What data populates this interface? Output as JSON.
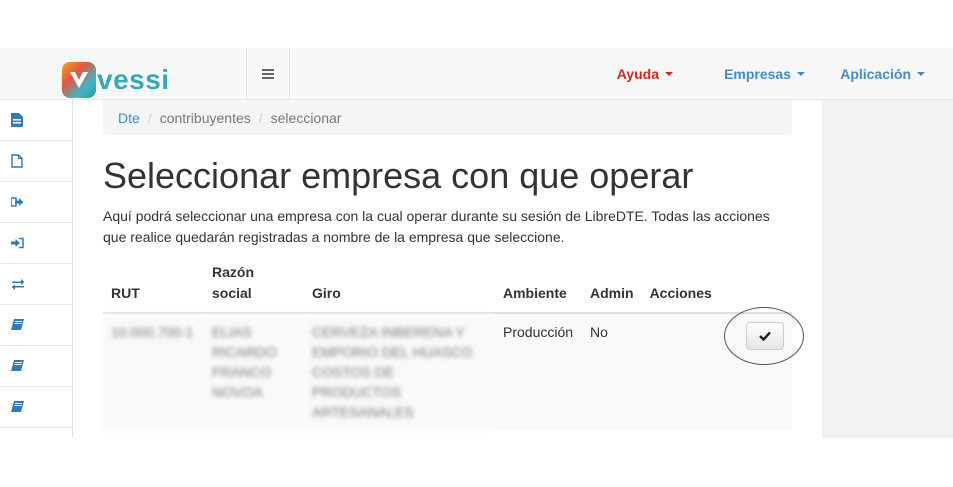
{
  "brand": {
    "name": "vessi"
  },
  "navbar": {
    "toggle_icon": "hamburger-icon",
    "menus": [
      {
        "label": "Ayuda",
        "color": "#d9251c"
      },
      {
        "label": "Empresas",
        "color": "#428bca"
      },
      {
        "label": "Aplicación",
        "color": "#428bca"
      }
    ]
  },
  "sidebar": {
    "icons": [
      "file-text-icon",
      "file-icon",
      "sign-out-icon",
      "sign-in-icon",
      "exchange-icon",
      "book-icon",
      "book-icon",
      "book-icon"
    ]
  },
  "breadcrumb": [
    "Dte",
    "contribuyentes",
    "seleccionar"
  ],
  "page": {
    "title": "Seleccionar empresa con que operar",
    "description": "Aquí podrá seleccionar una empresa con la cual operar durante su sesión de LibreDTE. Todas las acciones que realice quedarán registradas a nombre de la empresa que seleccione."
  },
  "table": {
    "headers": [
      "RUT",
      "Razón social",
      "Giro",
      "Ambiente",
      "Admin",
      "Acciones"
    ],
    "rows": [
      {
        "rut": "10.000.700-1",
        "razon_social": "ELIAS RICARDO FRANCO NOVOA",
        "giro": "CERVEZA INBERENA Y EMPORIO DEL HUASCO COSTOS DE PRODUCTOS ARTESANALES",
        "ambiente": "Producción",
        "admin": "No",
        "action_icon": "check-icon"
      }
    ]
  }
}
